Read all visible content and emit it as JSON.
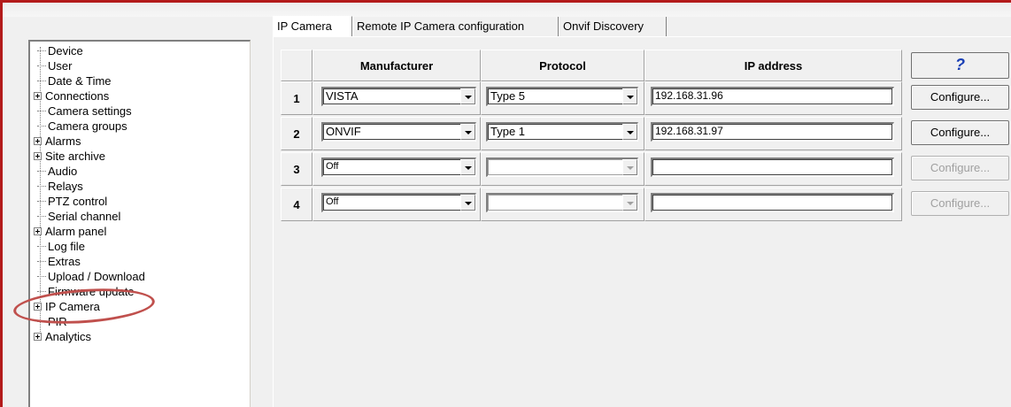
{
  "tree": {
    "items": [
      {
        "label": "Device",
        "expandable": false
      },
      {
        "label": "User",
        "expandable": false
      },
      {
        "label": "Date & Time",
        "expandable": false
      },
      {
        "label": "Connections",
        "expandable": true
      },
      {
        "label": "Camera settings",
        "expandable": false
      },
      {
        "label": "Camera groups",
        "expandable": false
      },
      {
        "label": "Alarms",
        "expandable": true
      },
      {
        "label": "Site archive",
        "expandable": true
      },
      {
        "label": "Audio",
        "expandable": false
      },
      {
        "label": "Relays",
        "expandable": false
      },
      {
        "label": "PTZ control",
        "expandable": false
      },
      {
        "label": "Serial channel",
        "expandable": false
      },
      {
        "label": "Alarm panel",
        "expandable": true
      },
      {
        "label": "Log file",
        "expandable": false
      },
      {
        "label": "Extras",
        "expandable": false
      },
      {
        "label": "Upload / Download",
        "expandable": false
      },
      {
        "label": "Firmware update",
        "expandable": false
      },
      {
        "label": "IP Camera",
        "expandable": true
      },
      {
        "label": "PIR",
        "expandable": false
      },
      {
        "label": "Analytics",
        "expandable": true
      }
    ],
    "highlighted_item": "IP Camera",
    "highlight_color": "#c0504d"
  },
  "tabs": [
    {
      "label": "IP Camera",
      "active": true
    },
    {
      "label": "Remote IP Camera configuration",
      "active": false
    },
    {
      "label": "Onvif Discovery",
      "active": false
    }
  ],
  "table": {
    "headers": {
      "manufacturer": "Manufacturer",
      "protocol": "Protocol",
      "ip": "IP address"
    },
    "help_label": "?",
    "rows": [
      {
        "num": "1",
        "manufacturer": "VISTA",
        "protocol": "Type 5",
        "ip": "192.168.31.96",
        "configure": "Configure...",
        "enabled": true
      },
      {
        "num": "2",
        "manufacturer": "ONVIF",
        "protocol": "Type 1",
        "ip": "192.168.31.97",
        "configure": "Configure...",
        "enabled": true
      },
      {
        "num": "3",
        "manufacturer": "Off",
        "protocol": "",
        "ip": "",
        "configure": "Configure...",
        "enabled": false
      },
      {
        "num": "4",
        "manufacturer": "Off",
        "protocol": "",
        "ip": "",
        "configure": "Configure...",
        "enabled": false
      }
    ]
  },
  "colors": {
    "frame": "#b31b1b",
    "help_icon": "#1a3fb5"
  }
}
